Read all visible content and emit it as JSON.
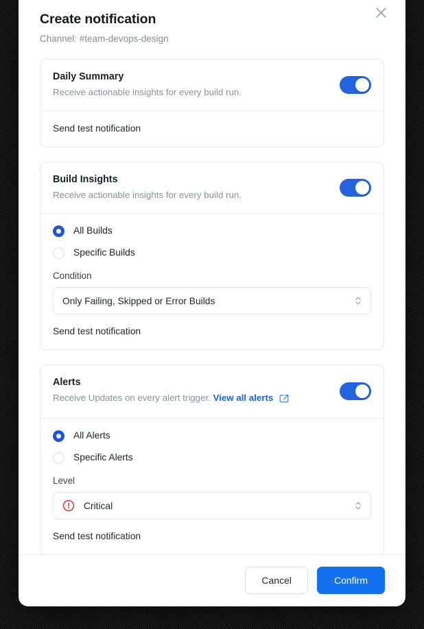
{
  "backdrop": {
    "color": "#000000"
  },
  "modal": {
    "title": "Create notification",
    "subtitle": "Channel: #team-devops-design",
    "close_icon": "close-icon"
  },
  "colors": {
    "accent_blue": "#1271ef",
    "toggle_blue": "#2463e0",
    "radio_blue": "#1a56db",
    "link_blue": "#1763d8",
    "critical_red": "#e02424",
    "border": "#e7e8ea",
    "muted_text": "#8b8f97"
  },
  "cards": [
    {
      "id": "daily-summary",
      "title": "Daily Summary",
      "description": "Receive actionable insights for every build run.",
      "toggle_on": true,
      "send_test_label": "Send test notification"
    },
    {
      "id": "build-insights",
      "title": "Build Insights",
      "description": "Receive actionable insights for every build run.",
      "toggle_on": true,
      "radios": [
        {
          "label": "All Builds",
          "selected": true
        },
        {
          "label": "Specific Builds",
          "selected": false
        }
      ],
      "field_label": "Condition",
      "select_value": "Only Failing, Skipped or Error Builds",
      "send_test_label": "Send test notification"
    },
    {
      "id": "alerts",
      "title": "Alerts",
      "description": "Receive Updates on every alert trigger.",
      "link_label": "View all alerts",
      "link_icon": "external-link-icon",
      "toggle_on": true,
      "radios": [
        {
          "label": "All Alerts",
          "selected": true
        },
        {
          "label": "Specific Alerts",
          "selected": false
        }
      ],
      "field_label": "Level",
      "select_value": "Critical",
      "select_icon": "critical-alert-icon",
      "send_test_label": "Send test notification"
    }
  ],
  "footer": {
    "cancel_label": "Cancel",
    "confirm_label": "Confirm"
  }
}
